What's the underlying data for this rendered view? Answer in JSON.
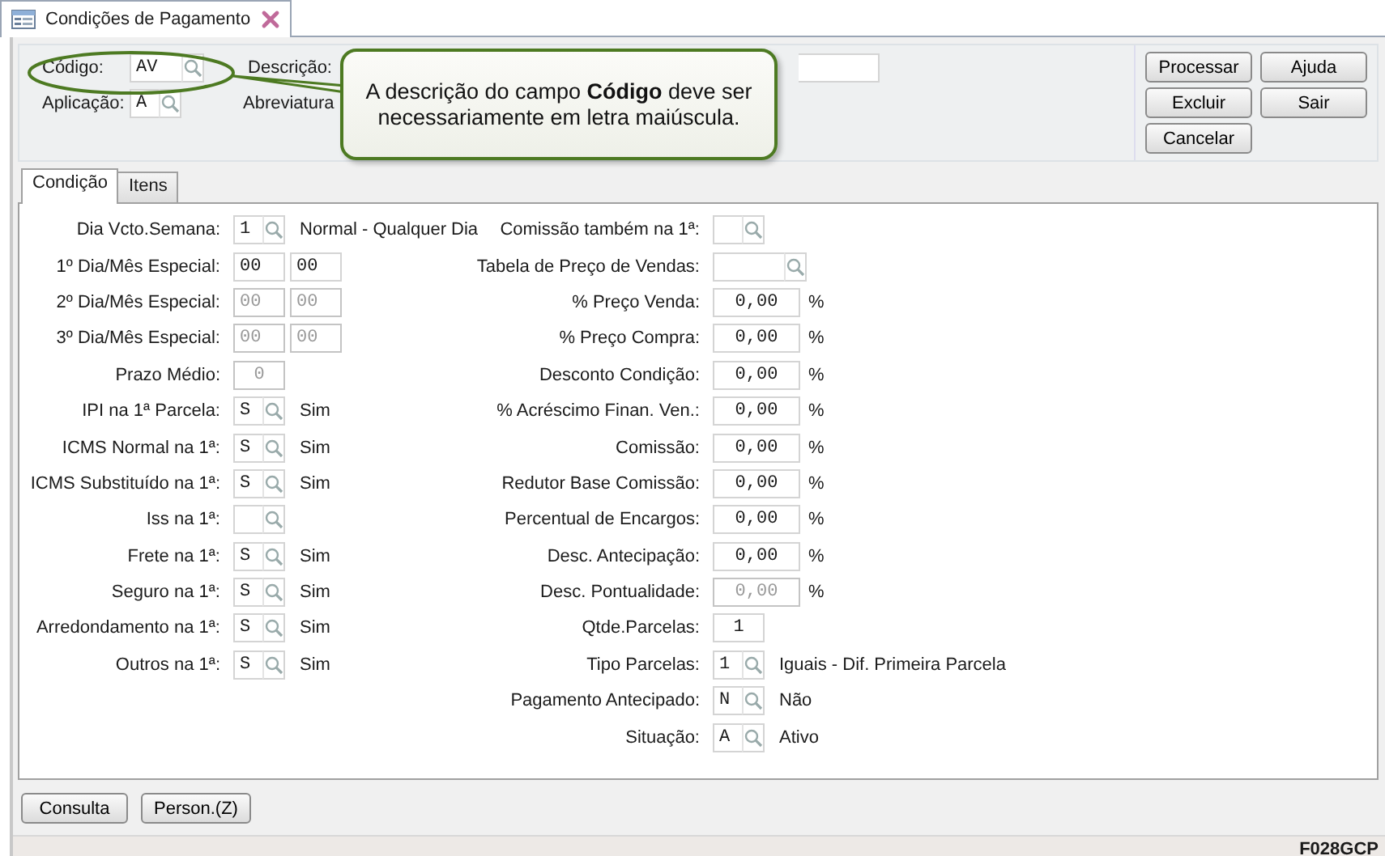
{
  "window_tab": {
    "title": "Condições de Pagamento"
  },
  "header": {
    "fields": [
      {
        "label": "Código:",
        "kind": "lookup",
        "value": "AV"
      },
      {
        "label": "Descrição:",
        "kind": "text"
      },
      {
        "label": "Aplicação:",
        "kind": "lookup",
        "value": "A"
      },
      {
        "label": "Abreviatura",
        "kind": "hidden"
      }
    ]
  },
  "buttons": [
    {
      "label": "Processar"
    },
    {
      "label": "Ajuda"
    },
    {
      "label": "Excluir"
    },
    {
      "label": "Sair"
    },
    {
      "label": "Cancelar"
    }
  ],
  "callout": {
    "text": "A descrição do campo **Código** deve ser necessariamente em letra maiúscula."
  },
  "tabs": [
    {
      "label": "Condição",
      "selected": true
    },
    {
      "label": "Itens",
      "selected": false
    }
  ],
  "left_fields": [
    {
      "label": "Dia Vcto.Semana:",
      "kind": "lookup",
      "value": "1",
      "description": "Normal - Qualquer Dia",
      "disabled": false
    },
    {
      "label": "1º Dia/Mês Especial:",
      "kind": "pair",
      "values": [
        "00",
        "00"
      ],
      "disabled": false
    },
    {
      "label": "2º Dia/Mês Especial:",
      "kind": "pair",
      "values": [
        "00",
        "00"
      ],
      "disabled": true
    },
    {
      "label": "3º Dia/Mês Especial:",
      "kind": "pair",
      "values": [
        "00",
        "00"
      ],
      "disabled": true
    },
    {
      "label": "Prazo Médio:",
      "kind": "number",
      "value": "0",
      "disabled": true
    },
    {
      "label": "IPI na 1ª Parcela:",
      "kind": "lookup",
      "value": "S",
      "description": "Sim",
      "disabled": false
    },
    {
      "label": "ICMS Normal na 1ª:",
      "kind": "lookup",
      "value": "S",
      "description": "Sim",
      "disabled": false
    },
    {
      "label": "ICMS Substituído na 1ª:",
      "kind": "lookup",
      "value": "S",
      "description": "Sim",
      "disabled": false
    },
    {
      "label": "Iss na 1ª:",
      "kind": "lookup",
      "disabled": false
    },
    {
      "label": "Frete na 1ª:",
      "kind": "lookup",
      "value": "S",
      "description": "Sim",
      "disabled": false
    },
    {
      "label": "Seguro na 1ª:",
      "kind": "lookup",
      "value": "S",
      "description": "Sim",
      "disabled": false
    },
    {
      "label": "Arredondamento na 1ª:",
      "kind": "lookup",
      "value": "S",
      "description": "Sim",
      "disabled": false
    },
    {
      "label": "Outros na 1ª:",
      "kind": "lookup",
      "value": "S",
      "description": "Sim",
      "disabled": false
    }
  ],
  "right_fields": [
    {
      "label": "Comissão também na 1ª:",
      "kind": "lookup",
      "disabled": false
    },
    {
      "label": "Tabela de Preço de Vendas:",
      "kind": "lookup_wide",
      "disabled": false
    },
    {
      "label": "% Preço Venda:",
      "kind": "percent",
      "value": "0,00",
      "unit": "%",
      "disabled": false
    },
    {
      "label": "% Preço Compra:",
      "kind": "percent",
      "value": "0,00",
      "unit": "%",
      "disabled": false
    },
    {
      "label": "Desconto Condição:",
      "kind": "percent",
      "value": "0,00",
      "unit": "%",
      "disabled": false
    },
    {
      "label": "% Acréscimo Finan. Ven.:",
      "kind": "percent",
      "value": "0,00",
      "unit": "%",
      "disabled": false
    },
    {
      "label": "Comissão:",
      "kind": "percent",
      "value": "0,00",
      "unit": "%",
      "disabled": false
    },
    {
      "label": "Redutor Base Comissão:",
      "kind": "percent",
      "value": "0,00",
      "unit": "%",
      "disabled": false
    },
    {
      "label": "Percentual de Encargos:",
      "kind": "percent",
      "value": "0,00",
      "unit": "%",
      "disabled": false
    },
    {
      "label": "Desc. Antecipação:",
      "kind": "percent",
      "value": "0,00",
      "unit": "%",
      "disabled": false
    },
    {
      "label": "Desc. Pontualidade:",
      "kind": "percent",
      "value": "0,00",
      "unit": "%",
      "disabled": true
    },
    {
      "label": "Qtde.Parcelas:",
      "kind": "number",
      "value": "1",
      "disabled": false
    },
    {
      "label": "Tipo Parcelas:",
      "kind": "lookup",
      "value": "1",
      "description": "Iguais - Dif. Primeira Parcela",
      "disabled": false
    },
    {
      "label": "Pagamento Antecipado:",
      "kind": "lookup",
      "value": "N",
      "description": "Não",
      "disabled": false
    },
    {
      "label": "Situação:",
      "kind": "lookup",
      "value": "A",
      "description": "Ativo",
      "disabled": false
    }
  ],
  "footer_buttons": [
    {
      "label": "Consulta"
    },
    {
      "label": "Person.(Z)"
    }
  ],
  "status_bar": {
    "code": "F028GCP"
  }
}
